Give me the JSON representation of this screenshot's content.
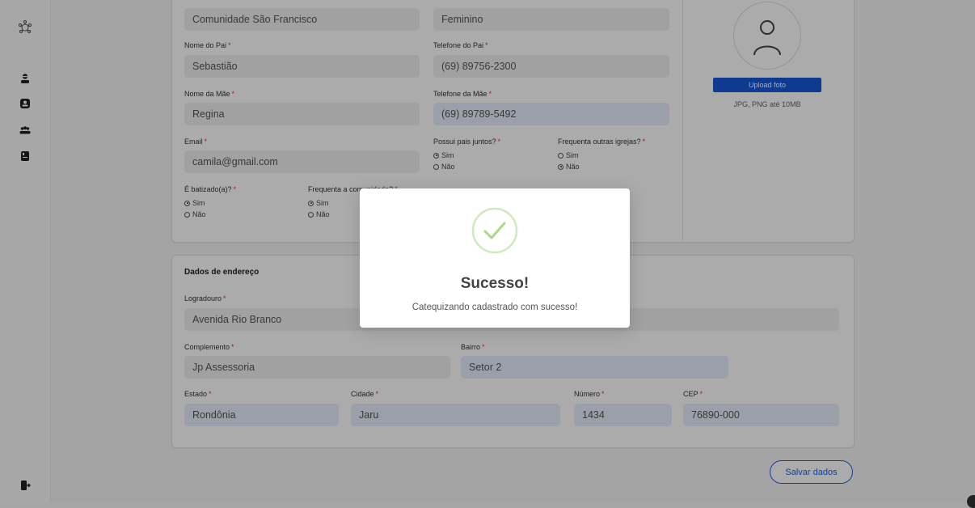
{
  "sidebar": {
    "icons": [
      "logo-icon",
      "user-icon",
      "person-card-icon",
      "group-icon",
      "book-icon",
      "logout-icon"
    ]
  },
  "personal": {
    "community_value": "Comunidade São Francisco",
    "gender_value": "Feminino",
    "father_name_label": "Nome do Pai",
    "father_name_value": "Sebastião",
    "father_phone_label": "Telefone do Pai",
    "father_phone_value": "(69) 89756-2300",
    "mother_name_label": "Nome da Mãe",
    "mother_name_value": "Regina",
    "mother_phone_label": "Telefone da Mãe",
    "mother_phone_value": "(69) 89789-5492",
    "email_label": "Email",
    "email_value": "camila@gmail.com",
    "parents_together_label": "Possui pais juntos?",
    "other_churches_label": "Frequenta outras igrejas?",
    "baptized_label": "É batizado(a)?",
    "community_attends_label": "Frequenta a comunidade?",
    "yes": "Sim",
    "no": "Não",
    "required_mark": "*",
    "upload_label": "Upload foto",
    "upload_hint": "JPG, PNG até 10MB"
  },
  "address": {
    "section_title": "Dados de endereço",
    "street_label": "Logradouro",
    "street_value": "Avenida Rio Branco",
    "complement_label": "Complemento",
    "complement_value": "Jp Assessoria",
    "district_label": "Bairro",
    "district_value": "Setor 2",
    "state_label": "Estado",
    "state_value": "Rondônia",
    "city_label": "Cidade",
    "city_value": "Jaru",
    "number_label": "Número",
    "number_value": "1434",
    "cep_label": "CEP",
    "cep_value": "76890-000"
  },
  "save_label": "Salvar dados",
  "modal": {
    "title": "Sucesso!",
    "message": "Catequizando cadastrado com sucesso!",
    "icon": "check-circle-icon"
  },
  "colors": {
    "primary": "#1559d6",
    "success": "#a5dc86",
    "required": "#e53935"
  }
}
